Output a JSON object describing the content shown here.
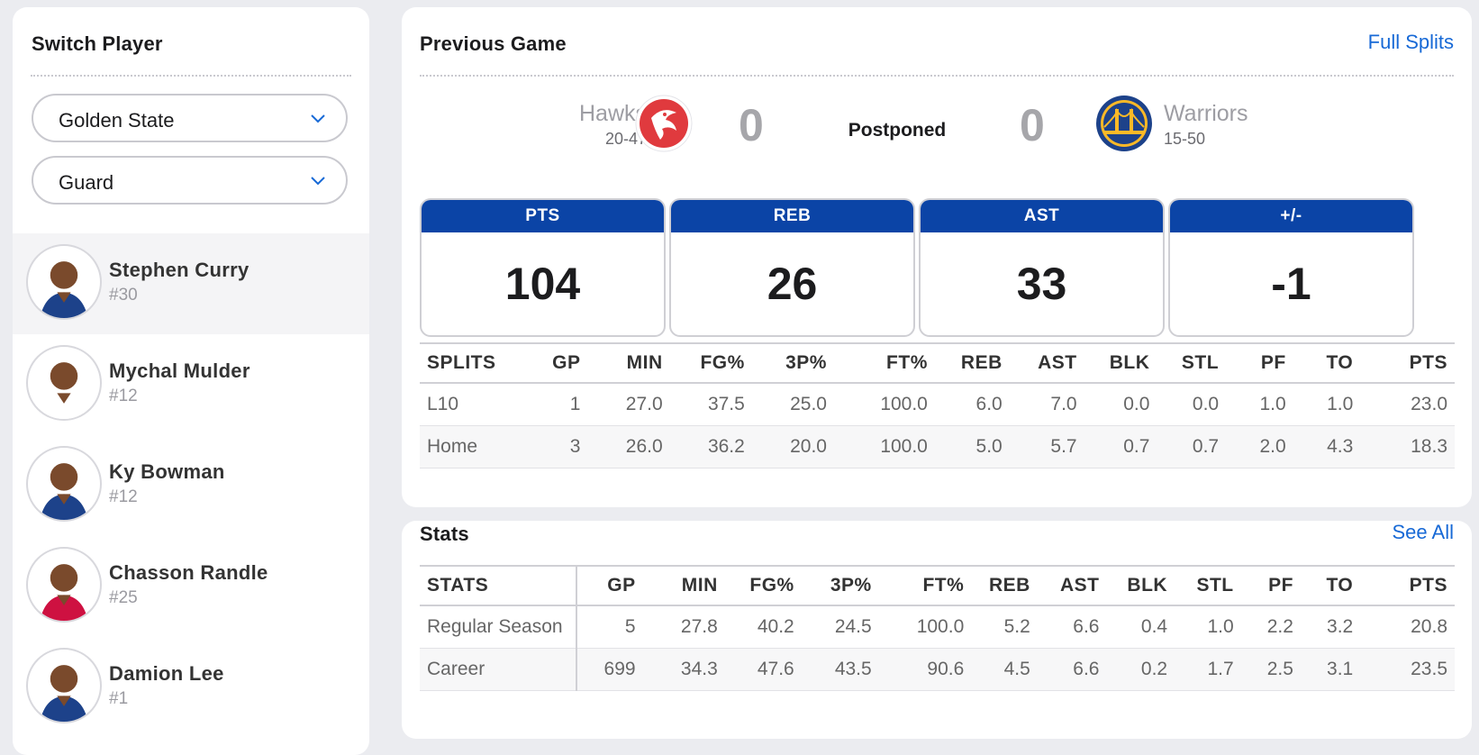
{
  "sidebar": {
    "title": "Switch Player",
    "team_select": "Golden State",
    "position_select": "Guard",
    "players": [
      {
        "name": "Stephen Curry",
        "number": "#30",
        "active": true,
        "jersey": "#1d428a"
      },
      {
        "name": "Mychal Mulder",
        "number": "#12",
        "active": false,
        "jersey": "#ffffff"
      },
      {
        "name": "Ky Bowman",
        "number": "#12",
        "active": false,
        "jersey": "#1d428a"
      },
      {
        "name": "Chasson Randle",
        "number": "#25",
        "active": false,
        "jersey": "#ce1141"
      },
      {
        "name": "Damion Lee",
        "number": "#1",
        "active": false,
        "jersey": "#1d428a"
      }
    ]
  },
  "previous_game": {
    "title": "Previous Game",
    "link": "Full Splits",
    "away": {
      "name": "Hawks",
      "record": "20-47",
      "score": "0",
      "color": "#e03a3e"
    },
    "home": {
      "name": "Warriors",
      "record": "15-50",
      "score": "0",
      "color": "#1d428a"
    },
    "status": "Postponed",
    "boxes": [
      {
        "label": "PTS",
        "value": "104"
      },
      {
        "label": "REB",
        "value": "26"
      },
      {
        "label": "AST",
        "value": "33"
      },
      {
        "label": "+/-",
        "value": "-1"
      }
    ],
    "splits": {
      "headers": [
        "SPLITS",
        "GP",
        "MIN",
        "FG%",
        "3P%",
        "FT%",
        "REB",
        "AST",
        "BLK",
        "STL",
        "PF",
        "TO",
        "PTS"
      ],
      "rows": [
        [
          "L10",
          "1",
          "27.0",
          "37.5",
          "25.0",
          "100.0",
          "6.0",
          "7.0",
          "0.0",
          "0.0",
          "1.0",
          "1.0",
          "23.0"
        ],
        [
          "Home",
          "3",
          "26.0",
          "36.2",
          "20.0",
          "100.0",
          "5.0",
          "5.7",
          "0.7",
          "0.7",
          "2.0",
          "4.3",
          "18.3"
        ]
      ]
    }
  },
  "stats": {
    "title": "Stats",
    "link": "See All",
    "headers": [
      "STATS",
      "GP",
      "MIN",
      "FG%",
      "3P%",
      "FT%",
      "REB",
      "AST",
      "BLK",
      "STL",
      "PF",
      "TO",
      "PTS"
    ],
    "rows": [
      [
        "Regular Season",
        "5",
        "27.8",
        "40.2",
        "24.5",
        "100.0",
        "5.2",
        "6.6",
        "0.4",
        "1.0",
        "2.2",
        "3.2",
        "20.8"
      ],
      [
        "Career",
        "699",
        "34.3",
        "47.6",
        "43.5",
        "90.6",
        "4.5",
        "6.6",
        "0.2",
        "1.7",
        "2.5",
        "3.1",
        "23.5"
      ]
    ]
  },
  "colors": {
    "accent": "#1769d6",
    "header_blue": "#0b44a6"
  }
}
